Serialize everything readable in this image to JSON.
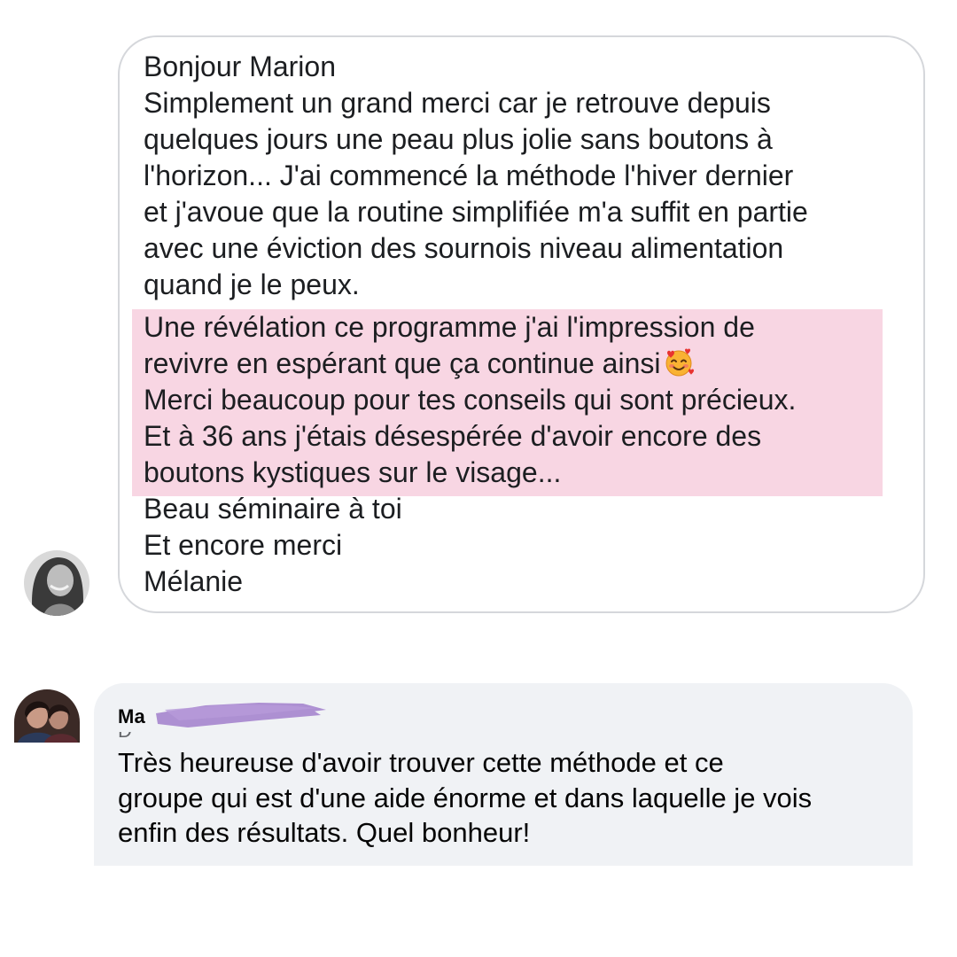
{
  "message1": {
    "avatar_icon": "person-avatar-icon",
    "lines_intro": [
      "Bonjour Marion",
      "Simplement un grand merci car je retrouve depuis",
      "quelques jours une peau plus jolie sans boutons à",
      "l'horizon... J'ai commencé la méthode l'hiver dernier",
      "et j'avoue que la routine simplifiée m'a suffit en partie",
      "avec une éviction des sournois niveau alimentation",
      "quand je le peux."
    ],
    "lines_highlighted": [
      "Une révélation ce programme j'ai l'impression de",
      "revivre en espérant que ça continue ainsi",
      "Merci beaucoup pour tes conseils qui sont précieux.",
      "Et à 36 ans j'étais désespérée d'avoir encore des",
      "boutons kystiques sur le visage..."
    ],
    "emoji_icon": "smiling-face-with-hearts-emoji",
    "lines_closing": [
      "Beau séminaire à toi",
      "Et encore merci",
      "Mélanie"
    ],
    "highlight_color": "#f8d6e3",
    "border_color": "#d5d7db"
  },
  "message2": {
    "avatar_icon": "person-avatar-icon",
    "author_visible": "Ma",
    "author_sub_visible": "D",
    "redaction_icon": "redaction-scribble",
    "redaction_color": "#a98ad0",
    "lines": [
      "Très heureuse d'avoir trouver cette méthode et ce",
      "groupe qui est d'une aide énorme et dans laquelle je vois",
      "enfin des résultats. Quel bonheur!"
    ],
    "bubble_color": "#f0f2f5"
  }
}
